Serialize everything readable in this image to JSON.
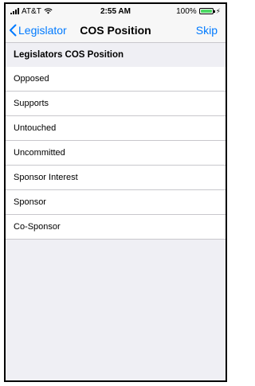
{
  "status_bar": {
    "carrier": "AT&T",
    "time": "2:55 AM",
    "battery": "100%",
    "battery_level": 1.0
  },
  "nav": {
    "back_label": "Legislator",
    "title": "COS Position",
    "skip_label": "Skip"
  },
  "section_header": "Legislators COS Position",
  "options": [
    "Opposed",
    "Supports",
    "Untouched",
    "Uncommitted",
    "Sponsor Interest",
    "Sponsor",
    "Co-Sponsor"
  ],
  "colors": {
    "accent": "#007aff",
    "background": "#efeff4",
    "separator": "#c8c7cc",
    "battery": "#4cd964"
  }
}
